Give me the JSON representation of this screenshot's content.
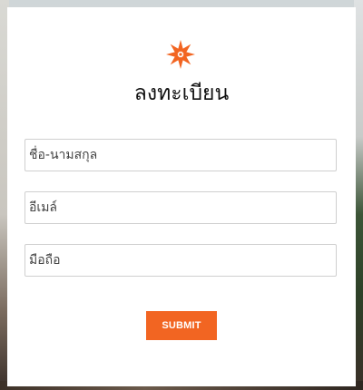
{
  "form": {
    "title": "ลงทะเบียน",
    "logo_icon": "orange-flower-star-icon",
    "accent_color": "#f26522",
    "fields": [
      {
        "placeholder": "ชื่อ-นามสกุล",
        "value": ""
      },
      {
        "placeholder": "อีเมล์",
        "value": ""
      },
      {
        "placeholder": "มือถือ",
        "value": ""
      }
    ],
    "submit_label": "SUBMIT"
  }
}
